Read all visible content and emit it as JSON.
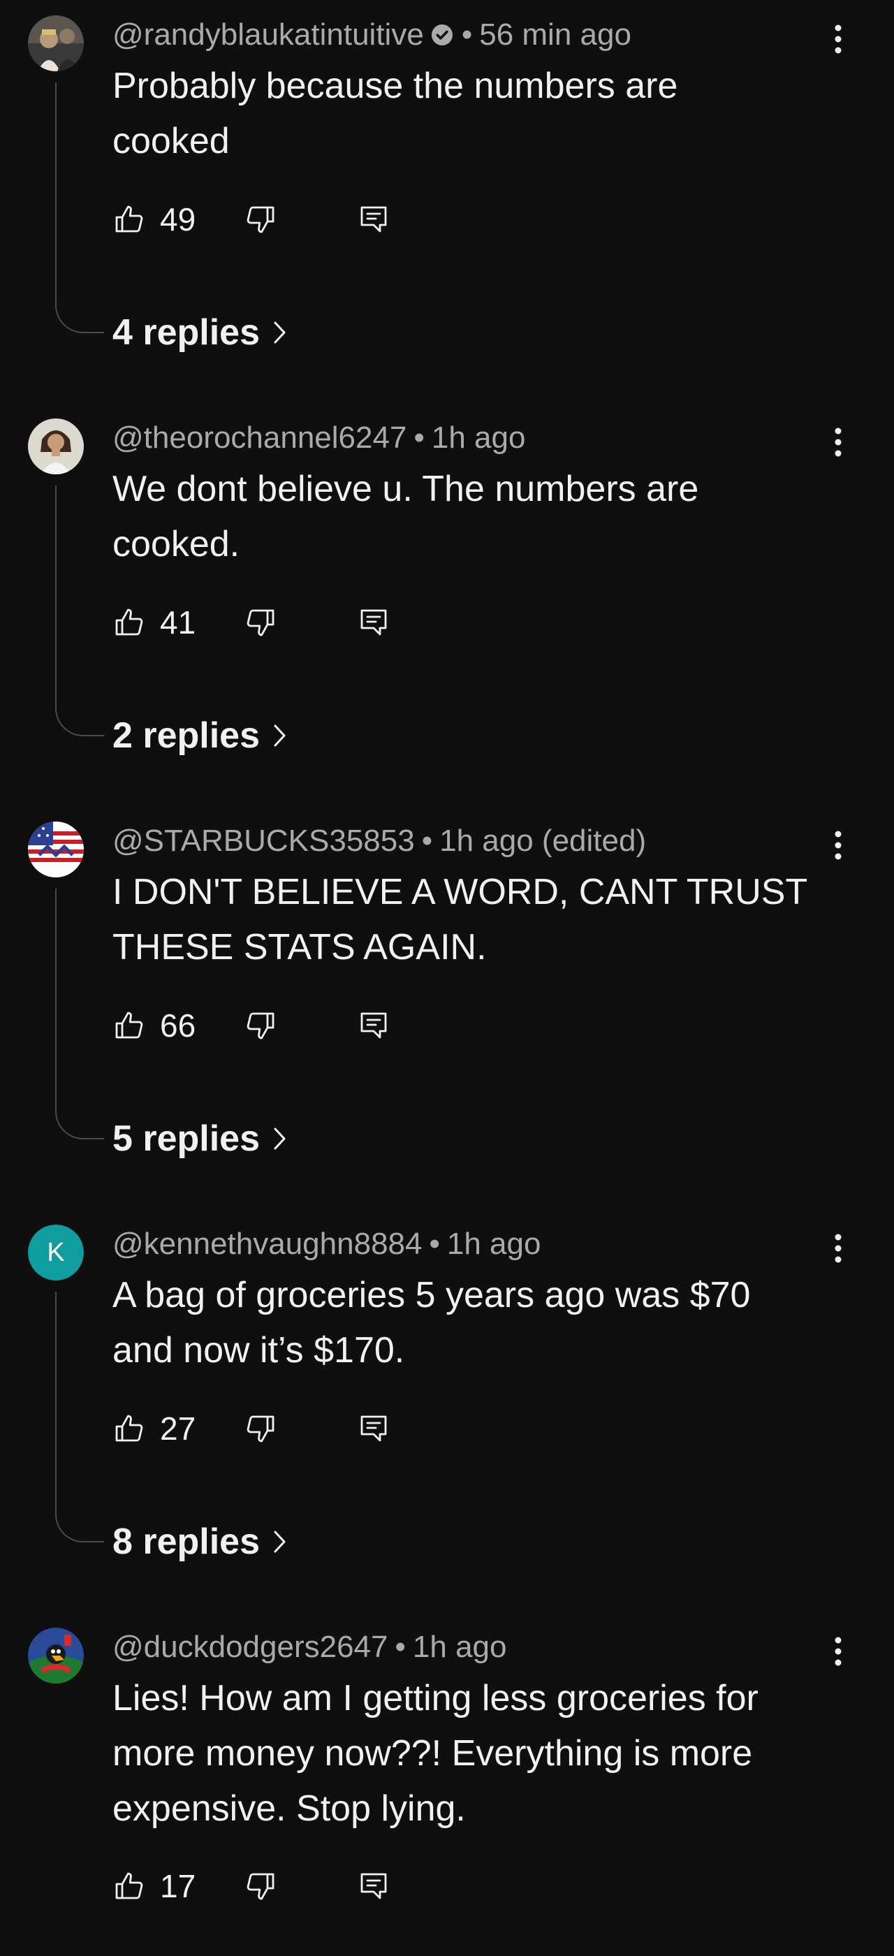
{
  "comments": [
    {
      "handle": "@randyblaukatintuitive",
      "verified": true,
      "time": "56 min ago",
      "text": "Probably because the numbers are cooked",
      "likes": "49",
      "replies_label": "4 replies"
    },
    {
      "handle": "@theorochannel6247",
      "verified": false,
      "time": "1h ago",
      "text": "We dont believe u. The numbers are cooked.",
      "likes": "41",
      "replies_label": "2 replies"
    },
    {
      "handle": "@STARBUCKS35853",
      "verified": false,
      "time": "1h ago (edited)",
      "text": "I DON'T BELIEVE A WORD, CANT TRUST THESE STATS AGAIN.",
      "likes": "66",
      "replies_label": "5 replies"
    },
    {
      "handle": "@kennethvaughn8884",
      "verified": false,
      "time": "1h ago",
      "text": "A bag of groceries 5 years ago was $70 and now it’s $170.",
      "likes": "27",
      "replies_label": "8 replies",
      "avatar_letter": "K",
      "avatar_color": "#0f9d9f"
    },
    {
      "handle": "@duckdodgers2647",
      "verified": false,
      "time": "1h ago",
      "text": "Lies! How am I getting less groceries for more money now??! Everything is more expensive. Stop lying.",
      "likes": "17"
    }
  ],
  "separator": "•",
  "icons": {
    "like": "thumbs-up-icon",
    "dislike": "thumbs-down-icon",
    "reply": "reply-comment-icon",
    "more": "more-vertical-icon",
    "verified": "verified-check-icon",
    "chevron": "chevron-right-icon"
  },
  "colors": {
    "background": "#0f0f0f",
    "text_primary": "#f1f1f1",
    "text_secondary": "#aaaaaa",
    "thread_line": "#4a4a4a"
  }
}
